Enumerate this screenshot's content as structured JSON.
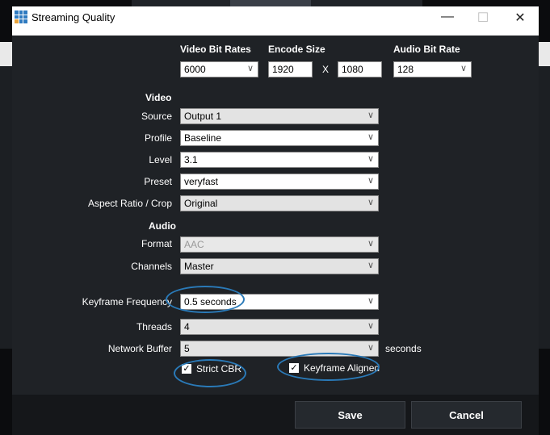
{
  "window": {
    "title": "Streaming Quality",
    "minimize": "—",
    "maximize": "☐",
    "close": "✕"
  },
  "top": {
    "video_bit_rates_label": "Video Bit Rates",
    "video_bit_rate": "6000",
    "encode_size_label": "Encode Size",
    "width": "1920",
    "x": "X",
    "height": "1080",
    "audio_bit_rate_label": "Audio Bit Rate",
    "audio_bit_rate": "128"
  },
  "video": {
    "header": "Video",
    "source_label": "Source",
    "source": "Output 1",
    "profile_label": "Profile",
    "profile": "Baseline",
    "level_label": "Level",
    "level": "3.1",
    "preset_label": "Preset",
    "preset": "veryfast",
    "aspect_label": "Aspect Ratio / Crop",
    "aspect": "Original"
  },
  "audio": {
    "header": "Audio",
    "format_label": "Format",
    "format": "AAC",
    "channels_label": "Channels",
    "channels": "Master"
  },
  "advanced": {
    "keyframe_label": "Keyframe Frequency",
    "keyframe": "0.5 seconds",
    "threads_label": "Threads",
    "threads": "4",
    "buffer_label": "Network Buffer",
    "buffer": "5",
    "buffer_unit": "seconds",
    "strict_cbr": "Strict CBR",
    "strict_cbr_checked": true,
    "keyframe_aligned": "Keyframe Aligned",
    "keyframe_aligned_checked": true
  },
  "buttons": {
    "save": "Save",
    "cancel": "Cancel"
  },
  "colors": {
    "annotation": "#2a7ab8"
  }
}
